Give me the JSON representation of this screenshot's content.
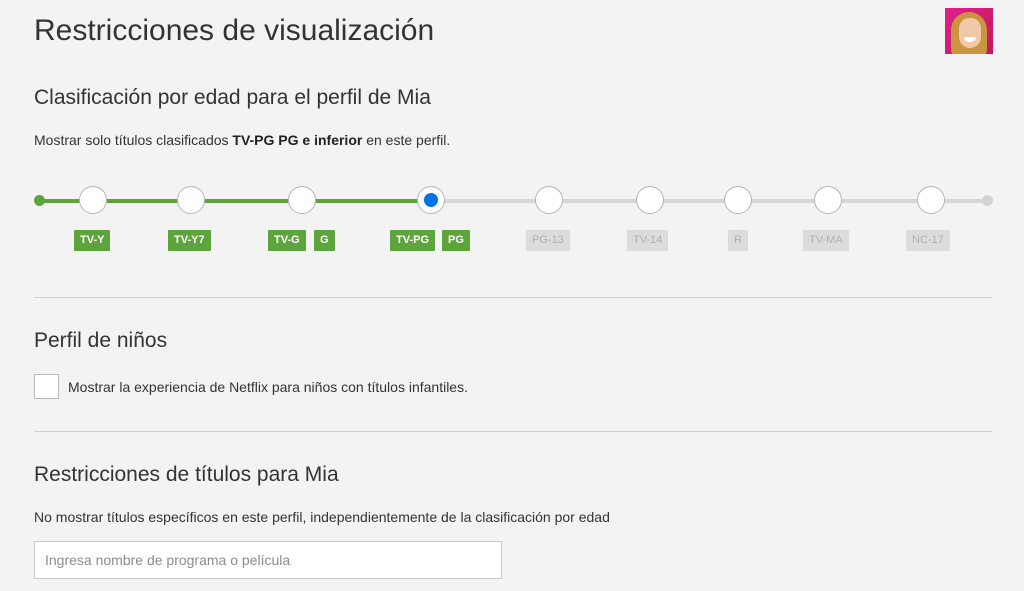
{
  "page": {
    "title": "Restricciones de visualización"
  },
  "avatar": {
    "label": ""
  },
  "maturity": {
    "heading": "Clasificación por edad para el perfil de Mia",
    "desc_prefix": "Mostrar solo títulos clasificados ",
    "desc_bold": "TV-PG PG e inferior",
    "desc_suffix": " en este perfil.",
    "selected_index": 3,
    "accent_color": "#5ea43c",
    "selected_color": "#0073e6",
    "badges": [
      {
        "label": "TV-Y",
        "active": true
      },
      {
        "label": "TV-Y7",
        "active": true
      },
      {
        "label": "TV-G",
        "active": true
      },
      {
        "label": "G",
        "active": true
      },
      {
        "label": "TV-PG",
        "active": true
      },
      {
        "label": "PG",
        "active": true
      },
      {
        "label": "PG-13",
        "active": false
      },
      {
        "label": "TV-14",
        "active": false
      },
      {
        "label": "R",
        "active": false
      },
      {
        "label": "TV-MA",
        "active": false
      },
      {
        "label": "NC-17",
        "active": false
      }
    ]
  },
  "kids": {
    "heading": "Perfil de niños",
    "checkbox_label": "Mostrar la experiencia de Netflix para niños con títulos infantiles.",
    "checked": false
  },
  "title_restrictions": {
    "heading": "Restricciones de títulos para Mia",
    "desc": "No mostrar títulos específicos en este perfil, independientemente de la clasificación por edad",
    "search_placeholder": "Ingresa nombre de programa o película",
    "search_value": ""
  }
}
